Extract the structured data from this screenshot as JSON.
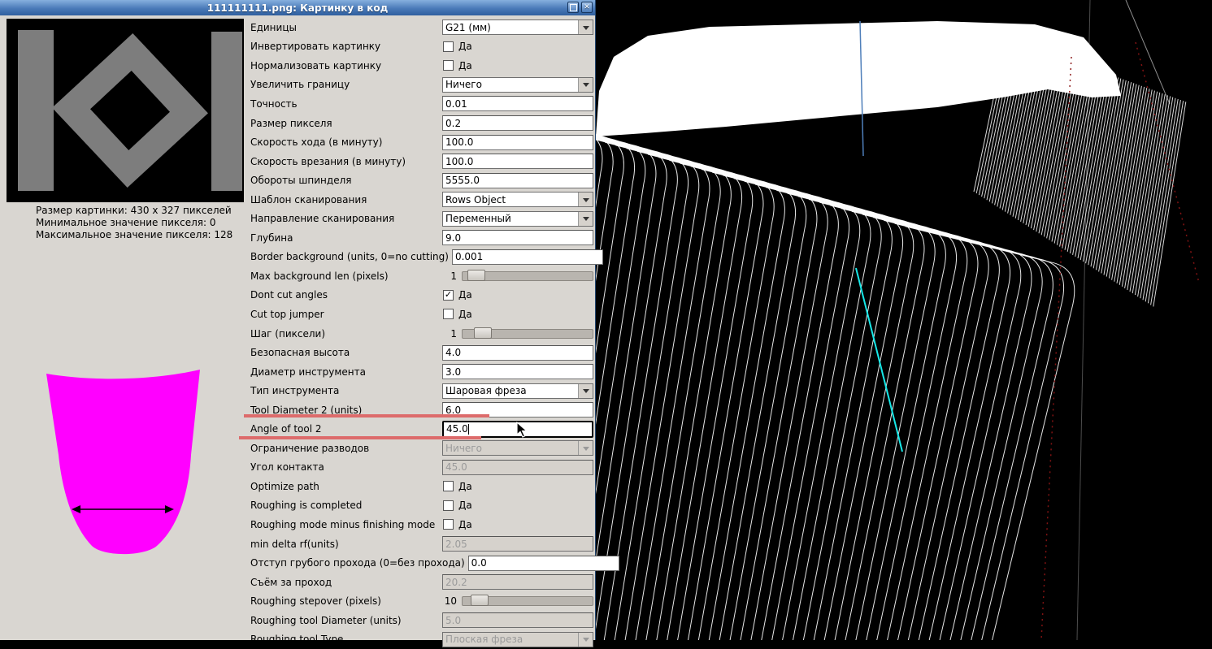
{
  "window": {
    "title": "111111111.png: Картинку в код",
    "close_glyph": "✕"
  },
  "preview": {
    "info_lines": [
      "Размер картинки: 430 x 327 пикселей",
      "Минимальное значение пикселя: 0",
      "Максимальное значение пикселя: 128"
    ],
    "shape_color": "#7d7d7d",
    "background": "#000000"
  },
  "tool_preview": {
    "color": "#ff00ff"
  },
  "annotation": {
    "color": "#dd6b6b"
  },
  "form": {
    "yes_label": "Да",
    "check_glyph": "✓",
    "rows": [
      {
        "name": "units",
        "label": "Единицы",
        "type": "combo",
        "value": "G21 (мм)"
      },
      {
        "name": "invert-image",
        "label": "Инвертировать картинку",
        "type": "check",
        "checked": false
      },
      {
        "name": "normalize-image",
        "label": "Нормализовать картинку",
        "type": "check",
        "checked": false
      },
      {
        "name": "expand-border",
        "label": "Увеличить границу",
        "type": "combo",
        "value": "Ничего"
      },
      {
        "name": "tolerance",
        "label": "Точность",
        "type": "entry",
        "value": "0.01"
      },
      {
        "name": "pixel-size",
        "label": "Размер пикселя",
        "type": "entry",
        "value": "0.2"
      },
      {
        "name": "feed-rate",
        "label": "Скорость хода (в минуту)",
        "type": "entry",
        "value": "100.0"
      },
      {
        "name": "plunge-rate",
        "label": "Скорость врезания (в минуту)",
        "type": "entry",
        "value": "100.0"
      },
      {
        "name": "spindle-speed",
        "label": "Обороты шпинделя",
        "type": "entry",
        "value": "5555.0"
      },
      {
        "name": "scan-pattern",
        "label": "Шаблон сканирования",
        "type": "combo",
        "value": "Rows Object"
      },
      {
        "name": "scan-direction",
        "label": "Направление сканирования",
        "type": "combo",
        "value": "Переменный"
      },
      {
        "name": "depth",
        "label": "Глубина",
        "type": "entry",
        "value": "9.0"
      },
      {
        "name": "border-background",
        "label": "Border background (units, 0=no cutting)",
        "type": "entry",
        "value": "0.001"
      },
      {
        "name": "max-background-len",
        "label": "Max background len (pixels)",
        "type": "scale",
        "value": "1",
        "fraction": 0.04
      },
      {
        "name": "dont-cut-angles",
        "label": "Dont cut angles",
        "type": "check",
        "checked": true
      },
      {
        "name": "cut-top-jumper",
        "label": "Cut top jumper",
        "type": "check",
        "checked": false
      },
      {
        "name": "step-pixels",
        "label": "Шаг (пиксели)",
        "type": "scale",
        "value": "1",
        "fraction": 0.1
      },
      {
        "name": "safety-height",
        "label": "Безопасная высота",
        "type": "entry",
        "value": "4.0"
      },
      {
        "name": "tool-diameter",
        "label": "Диаметр инструмента",
        "type": "entry",
        "value": "3.0"
      },
      {
        "name": "tool-type",
        "label": "Тип инструмента",
        "type": "combo",
        "value": "Шаровая фреза"
      },
      {
        "name": "tool-diameter-2",
        "label": "Tool Diameter 2 (units)",
        "type": "entry",
        "value": "6.0"
      },
      {
        "name": "angle-of-tool-2",
        "label": "Angle of tool 2",
        "type": "entry",
        "value": "45.0",
        "focused": true
      },
      {
        "name": "fillet-limit",
        "label": "Ограничение разводов",
        "type": "combo",
        "value": "Ничего",
        "disabled": true
      },
      {
        "name": "contact-angle",
        "label": "Угол контакта",
        "type": "entry",
        "value": "45.0",
        "disabled": true
      },
      {
        "name": "optimize-path",
        "label": "Optimize path",
        "type": "check",
        "checked": false
      },
      {
        "name": "roughing-is-completed",
        "label": "Roughing is completed",
        "type": "check",
        "checked": false
      },
      {
        "name": "roughing-minus-finishing",
        "label": "Roughing mode minus finishing mode",
        "type": "check",
        "checked": false
      },
      {
        "name": "min-delta-rf",
        "label": "min delta rf(units)",
        "type": "entry",
        "value": "2.05",
        "disabled": true
      },
      {
        "name": "roughing-offset",
        "label": "Отступ грубого прохода (0=без прохода)",
        "type": "entry",
        "value": "0.0"
      },
      {
        "name": "depth-per-pass",
        "label": "Съём за проход",
        "type": "entry",
        "value": "20.2",
        "disabled": true
      },
      {
        "name": "roughing-stepover",
        "label": "Roughing stepover (pixels)",
        "type": "scale",
        "value": "10",
        "fraction": 0.07
      },
      {
        "name": "roughing-tool-diameter",
        "label": "Roughing tool Diameter (units)",
        "type": "entry",
        "value": "5.0",
        "disabled": true
      },
      {
        "name": "roughing-tool-type",
        "label": "Roughing tool Type",
        "type": "combo",
        "value": "Плоская фреза",
        "disabled": true
      }
    ]
  },
  "scene": {
    "background": "#000000",
    "path_color": "#ffffff",
    "cyan_line": "#17e8e8",
    "blue_line": "#4f7fba",
    "red_dashed": "#8a1414"
  }
}
